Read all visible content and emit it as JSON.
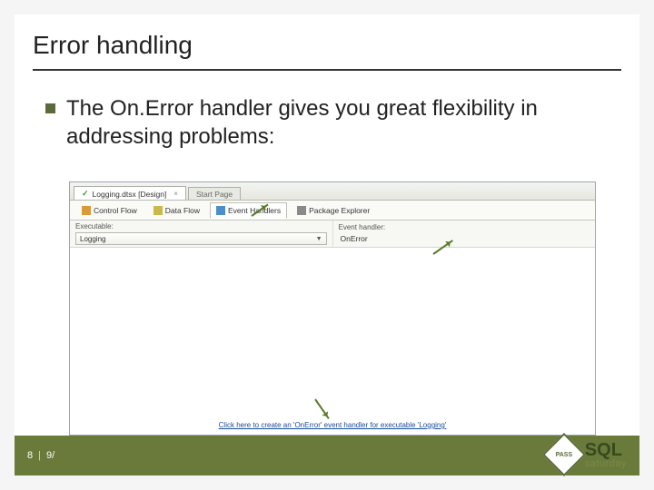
{
  "slide": {
    "title": "Error handling",
    "bullet": "The On.Error handler gives you great flexibility in addressing problems:"
  },
  "screenshot": {
    "file_tab_active": "Logging.dtsx [Design]",
    "file_tab_inactive": "Start Page",
    "tool_tabs": {
      "control_flow": "Control Flow",
      "data_flow": "Data Flow",
      "event_handlers": "Event Handlers",
      "package_explorer": "Package Explorer"
    },
    "executable_label": "Executable:",
    "executable_value": "Logging",
    "handler_label": "Event handler:",
    "handler_value": "OnError",
    "canvas_link": "Click here to create an 'OnError' event handler for executable 'Logging'"
  },
  "footer": {
    "page_number": "8",
    "date": "9/"
  },
  "branding": {
    "logo_badge": "PASS",
    "logo_main": "SQL",
    "logo_sub": "saturday"
  }
}
